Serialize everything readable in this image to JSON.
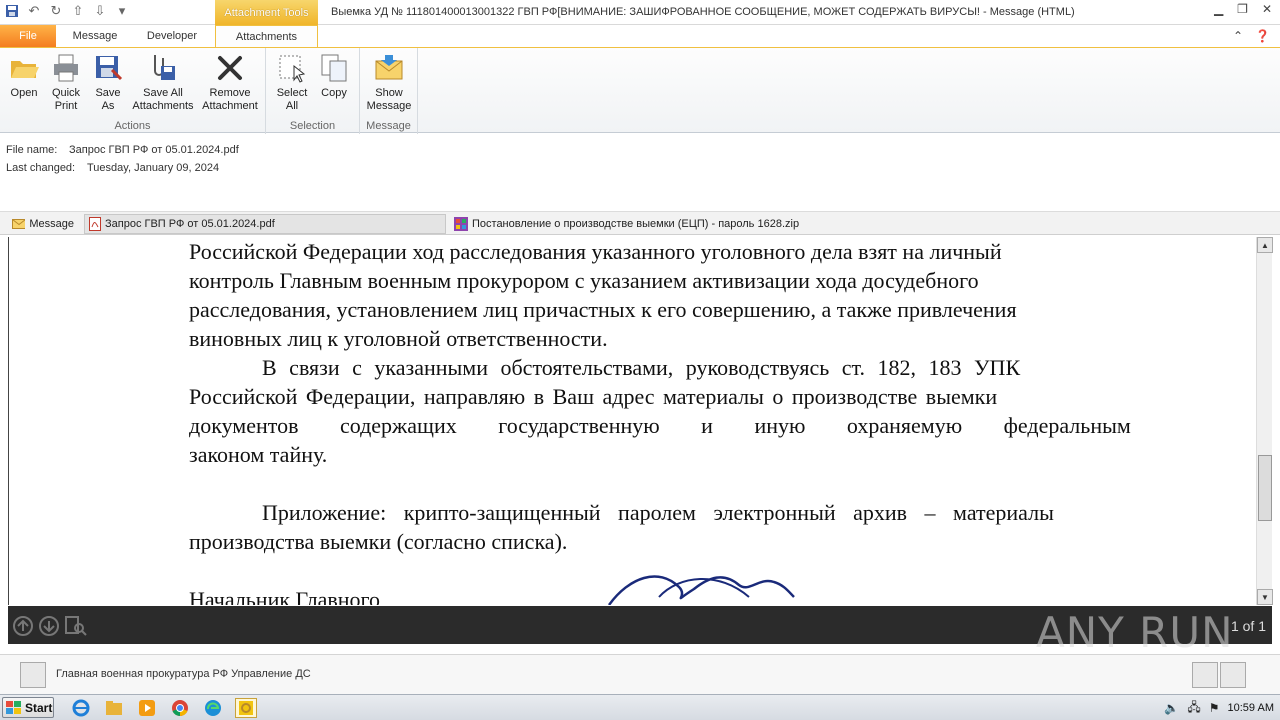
{
  "titlebar": {
    "context_tab": "Attachment Tools",
    "window_title": "Выемка УД № 111801400013001322  ГВП РФ[ВНИМАНИЕ: ЗАШИФРОВАННОЕ СООБЩЕНИЕ, МОЖЕТ СОДЕРЖАТЬ ВИРУСЫ!  -  Message (HTML)"
  },
  "tabs": {
    "file": "File",
    "message": "Message",
    "developer": "Developer",
    "attachments": "Attachments"
  },
  "ribbon": {
    "actions": {
      "label": "Actions",
      "open": "Open",
      "quick_print_1": "Quick",
      "quick_print_2": "Print",
      "save_as_1": "Save",
      "save_as_2": "As",
      "save_all_1": "Save All",
      "save_all_2": "Attachments",
      "remove_1": "Remove",
      "remove_2": "Attachment"
    },
    "selection": {
      "label": "Selection",
      "select_all_1": "Select",
      "select_all_2": "All",
      "copy": "Copy"
    },
    "message": {
      "label": "Message",
      "show_1": "Show",
      "show_2": "Message"
    }
  },
  "info": {
    "file_name_label": "File name:",
    "file_name": "Запрос ГВП РФ от 05.01.2024.pdf",
    "last_changed_label": "Last changed:",
    "last_changed": "Tuesday, January 09, 2024"
  },
  "attachments": {
    "message": "Message",
    "pdf": "Запрос ГВП РФ от 05.01.2024.pdf",
    "zip": "Постановление о производстве выемки (ЕЦП) - пароль 1628.zip"
  },
  "document": {
    "p1_l1": "Российской Федерации ход расследования указанного уголовного дела взят на личный",
    "p1_l2": "контроль Главным военным прокурором с указанием активизации хода досудебного",
    "p1_l3": "расследования, установлением лиц причастных к его совершению, а также привлечения",
    "p1_l4": "виновных лиц к уголовной ответственности.",
    "p2_l1": "В связи с указанными обстоятельствами, руководствуясь ст. 182, 183 УПК",
    "p2_l2": "Российской Федерации, направляю в Ваш адрес материалы о производстве выемки",
    "p2_l3": "документов содержащих государственную и иную охраняемую федеральным",
    "p2_l4": "законом тайну.",
    "p3_l1": "Приложение: крипто-защищенный паролем электронный архив – материалы",
    "p3_l2": "производства выемки (согласно списка).",
    "p4_l1": "Начальник Главного"
  },
  "viewer": {
    "page_count": "1 of 1"
  },
  "watermark": "ANY RUN",
  "people": {
    "sender": "Главная военная прокуратура РФ Управление ДС"
  },
  "taskbar": {
    "start": "Start",
    "clock": "10:59 AM"
  }
}
